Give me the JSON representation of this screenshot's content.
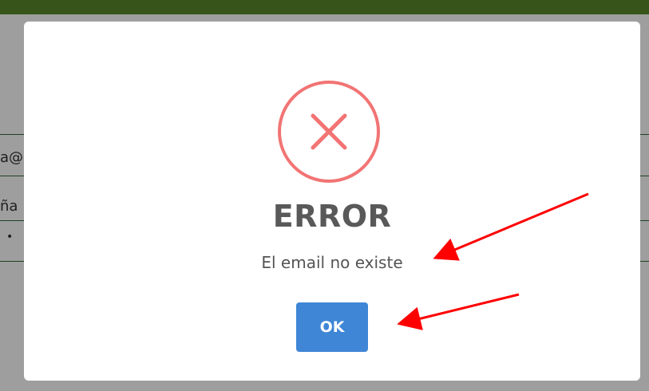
{
  "background": {
    "field_email_fragment": "a@",
    "field_password_fragment": "ña",
    "field_password_mask": "•"
  },
  "dialog": {
    "icon": "error-x-icon",
    "title": "ERROR",
    "message": "El email no existe",
    "ok_label": "OK"
  },
  "annotations": {
    "icon": "red-arrow-icon",
    "color": "#ff0000"
  },
  "colors": {
    "topbar": "#5a8a2c",
    "error_icon": "#f27474",
    "ok_button": "#3f86d6",
    "title_text": "#595959"
  }
}
